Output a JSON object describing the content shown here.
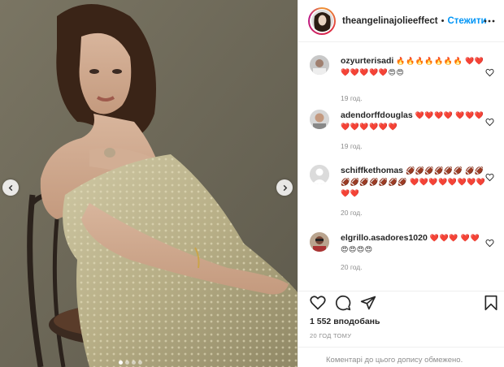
{
  "post": {
    "username": "theangelinajolieeffect",
    "separator": "•",
    "follow_label": "Стежити",
    "likes_text": "1 552 вподобань",
    "timestamp": "20 ГОД ТОМУ",
    "comments_closed": "Коментарі до цього допису обмежено."
  },
  "comments": [
    {
      "user": "ozyurterisadi",
      "text": "🔥🔥🔥🔥🔥🔥🔥 ❤️❤️❤️❤️❤️❤️❤️😍😍",
      "time": "19 год."
    },
    {
      "user": "adendorffdouglas",
      "text": "❤️❤️❤️❤️ ❤️❤️❤️❤️❤️❤️❤️❤️❤️",
      "time": "19 год."
    },
    {
      "user": "schiffkethomas",
      "text": "🏈🏈🏈🏈🏈🏈 🏈🏈🏈🏈🏈🏈🏈🏈🏈 ❤️❤️❤️❤️❤️❤️❤️❤️❤️❤️",
      "time": "20 год."
    },
    {
      "user": "elgrillo.asadores1020",
      "text": "❤️❤️❤️ ❤️❤️😍😍😍😍",
      "time": "20 год."
    }
  ],
  "carousel": {
    "slides": 4,
    "active_index": 0
  },
  "colors": {
    "accent": "#0095f6",
    "text": "#262626",
    "muted": "#8e8e8e",
    "border": "#efefef"
  },
  "icons": [
    "chevron-left-icon",
    "chevron-right-icon",
    "more-options-icon",
    "heart-icon",
    "comment-icon",
    "share-icon",
    "bookmark-icon"
  ]
}
